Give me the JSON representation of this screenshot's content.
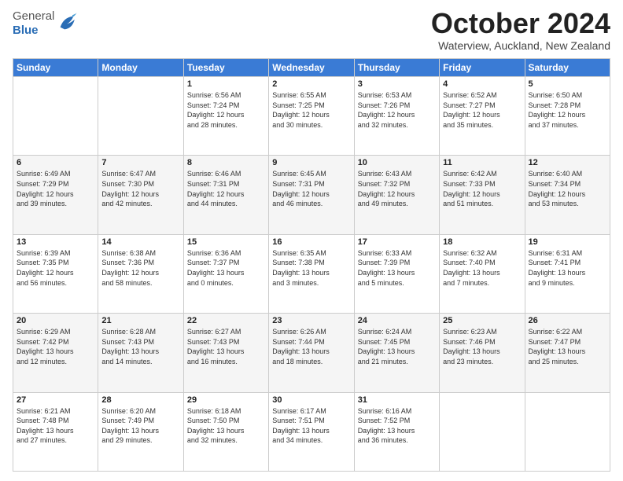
{
  "logo": {
    "general": "General",
    "blue": "Blue"
  },
  "title": {
    "month": "October 2024",
    "location": "Waterview, Auckland, New Zealand"
  },
  "header_days": [
    "Sunday",
    "Monday",
    "Tuesday",
    "Wednesday",
    "Thursday",
    "Friday",
    "Saturday"
  ],
  "weeks": [
    [
      {
        "day": "",
        "info": ""
      },
      {
        "day": "",
        "info": ""
      },
      {
        "day": "1",
        "info": "Sunrise: 6:56 AM\nSunset: 7:24 PM\nDaylight: 12 hours\nand 28 minutes."
      },
      {
        "day": "2",
        "info": "Sunrise: 6:55 AM\nSunset: 7:25 PM\nDaylight: 12 hours\nand 30 minutes."
      },
      {
        "day": "3",
        "info": "Sunrise: 6:53 AM\nSunset: 7:26 PM\nDaylight: 12 hours\nand 32 minutes."
      },
      {
        "day": "4",
        "info": "Sunrise: 6:52 AM\nSunset: 7:27 PM\nDaylight: 12 hours\nand 35 minutes."
      },
      {
        "day": "5",
        "info": "Sunrise: 6:50 AM\nSunset: 7:28 PM\nDaylight: 12 hours\nand 37 minutes."
      }
    ],
    [
      {
        "day": "6",
        "info": "Sunrise: 6:49 AM\nSunset: 7:29 PM\nDaylight: 12 hours\nand 39 minutes."
      },
      {
        "day": "7",
        "info": "Sunrise: 6:47 AM\nSunset: 7:30 PM\nDaylight: 12 hours\nand 42 minutes."
      },
      {
        "day": "8",
        "info": "Sunrise: 6:46 AM\nSunset: 7:31 PM\nDaylight: 12 hours\nand 44 minutes."
      },
      {
        "day": "9",
        "info": "Sunrise: 6:45 AM\nSunset: 7:31 PM\nDaylight: 12 hours\nand 46 minutes."
      },
      {
        "day": "10",
        "info": "Sunrise: 6:43 AM\nSunset: 7:32 PM\nDaylight: 12 hours\nand 49 minutes."
      },
      {
        "day": "11",
        "info": "Sunrise: 6:42 AM\nSunset: 7:33 PM\nDaylight: 12 hours\nand 51 minutes."
      },
      {
        "day": "12",
        "info": "Sunrise: 6:40 AM\nSunset: 7:34 PM\nDaylight: 12 hours\nand 53 minutes."
      }
    ],
    [
      {
        "day": "13",
        "info": "Sunrise: 6:39 AM\nSunset: 7:35 PM\nDaylight: 12 hours\nand 56 minutes."
      },
      {
        "day": "14",
        "info": "Sunrise: 6:38 AM\nSunset: 7:36 PM\nDaylight: 12 hours\nand 58 minutes."
      },
      {
        "day": "15",
        "info": "Sunrise: 6:36 AM\nSunset: 7:37 PM\nDaylight: 13 hours\nand 0 minutes."
      },
      {
        "day": "16",
        "info": "Sunrise: 6:35 AM\nSunset: 7:38 PM\nDaylight: 13 hours\nand 3 minutes."
      },
      {
        "day": "17",
        "info": "Sunrise: 6:33 AM\nSunset: 7:39 PM\nDaylight: 13 hours\nand 5 minutes."
      },
      {
        "day": "18",
        "info": "Sunrise: 6:32 AM\nSunset: 7:40 PM\nDaylight: 13 hours\nand 7 minutes."
      },
      {
        "day": "19",
        "info": "Sunrise: 6:31 AM\nSunset: 7:41 PM\nDaylight: 13 hours\nand 9 minutes."
      }
    ],
    [
      {
        "day": "20",
        "info": "Sunrise: 6:29 AM\nSunset: 7:42 PM\nDaylight: 13 hours\nand 12 minutes."
      },
      {
        "day": "21",
        "info": "Sunrise: 6:28 AM\nSunset: 7:43 PM\nDaylight: 13 hours\nand 14 minutes."
      },
      {
        "day": "22",
        "info": "Sunrise: 6:27 AM\nSunset: 7:43 PM\nDaylight: 13 hours\nand 16 minutes."
      },
      {
        "day": "23",
        "info": "Sunrise: 6:26 AM\nSunset: 7:44 PM\nDaylight: 13 hours\nand 18 minutes."
      },
      {
        "day": "24",
        "info": "Sunrise: 6:24 AM\nSunset: 7:45 PM\nDaylight: 13 hours\nand 21 minutes."
      },
      {
        "day": "25",
        "info": "Sunrise: 6:23 AM\nSunset: 7:46 PM\nDaylight: 13 hours\nand 23 minutes."
      },
      {
        "day": "26",
        "info": "Sunrise: 6:22 AM\nSunset: 7:47 PM\nDaylight: 13 hours\nand 25 minutes."
      }
    ],
    [
      {
        "day": "27",
        "info": "Sunrise: 6:21 AM\nSunset: 7:48 PM\nDaylight: 13 hours\nand 27 minutes."
      },
      {
        "day": "28",
        "info": "Sunrise: 6:20 AM\nSunset: 7:49 PM\nDaylight: 13 hours\nand 29 minutes."
      },
      {
        "day": "29",
        "info": "Sunrise: 6:18 AM\nSunset: 7:50 PM\nDaylight: 13 hours\nand 32 minutes."
      },
      {
        "day": "30",
        "info": "Sunrise: 6:17 AM\nSunset: 7:51 PM\nDaylight: 13 hours\nand 34 minutes."
      },
      {
        "day": "31",
        "info": "Sunrise: 6:16 AM\nSunset: 7:52 PM\nDaylight: 13 hours\nand 36 minutes."
      },
      {
        "day": "",
        "info": ""
      },
      {
        "day": "",
        "info": ""
      }
    ]
  ]
}
